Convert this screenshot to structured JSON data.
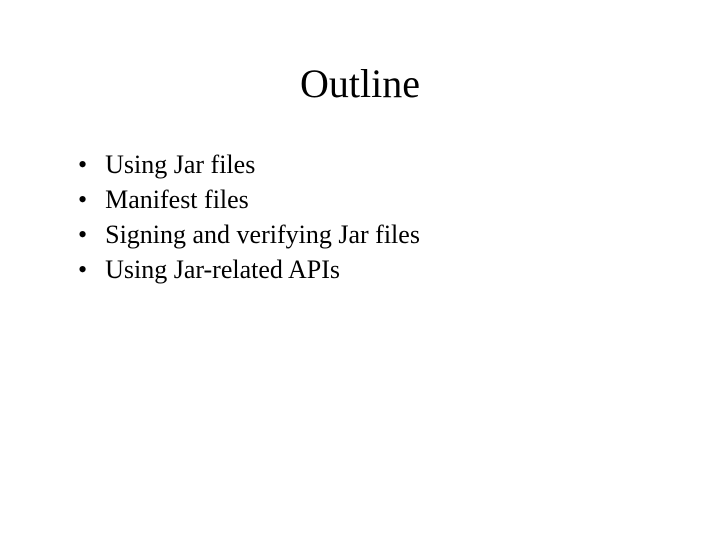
{
  "slide": {
    "title": "Outline",
    "bullets": [
      "Using Jar files",
      "Manifest files",
      "Signing and verifying Jar files",
      "Using Jar-related APIs"
    ]
  }
}
